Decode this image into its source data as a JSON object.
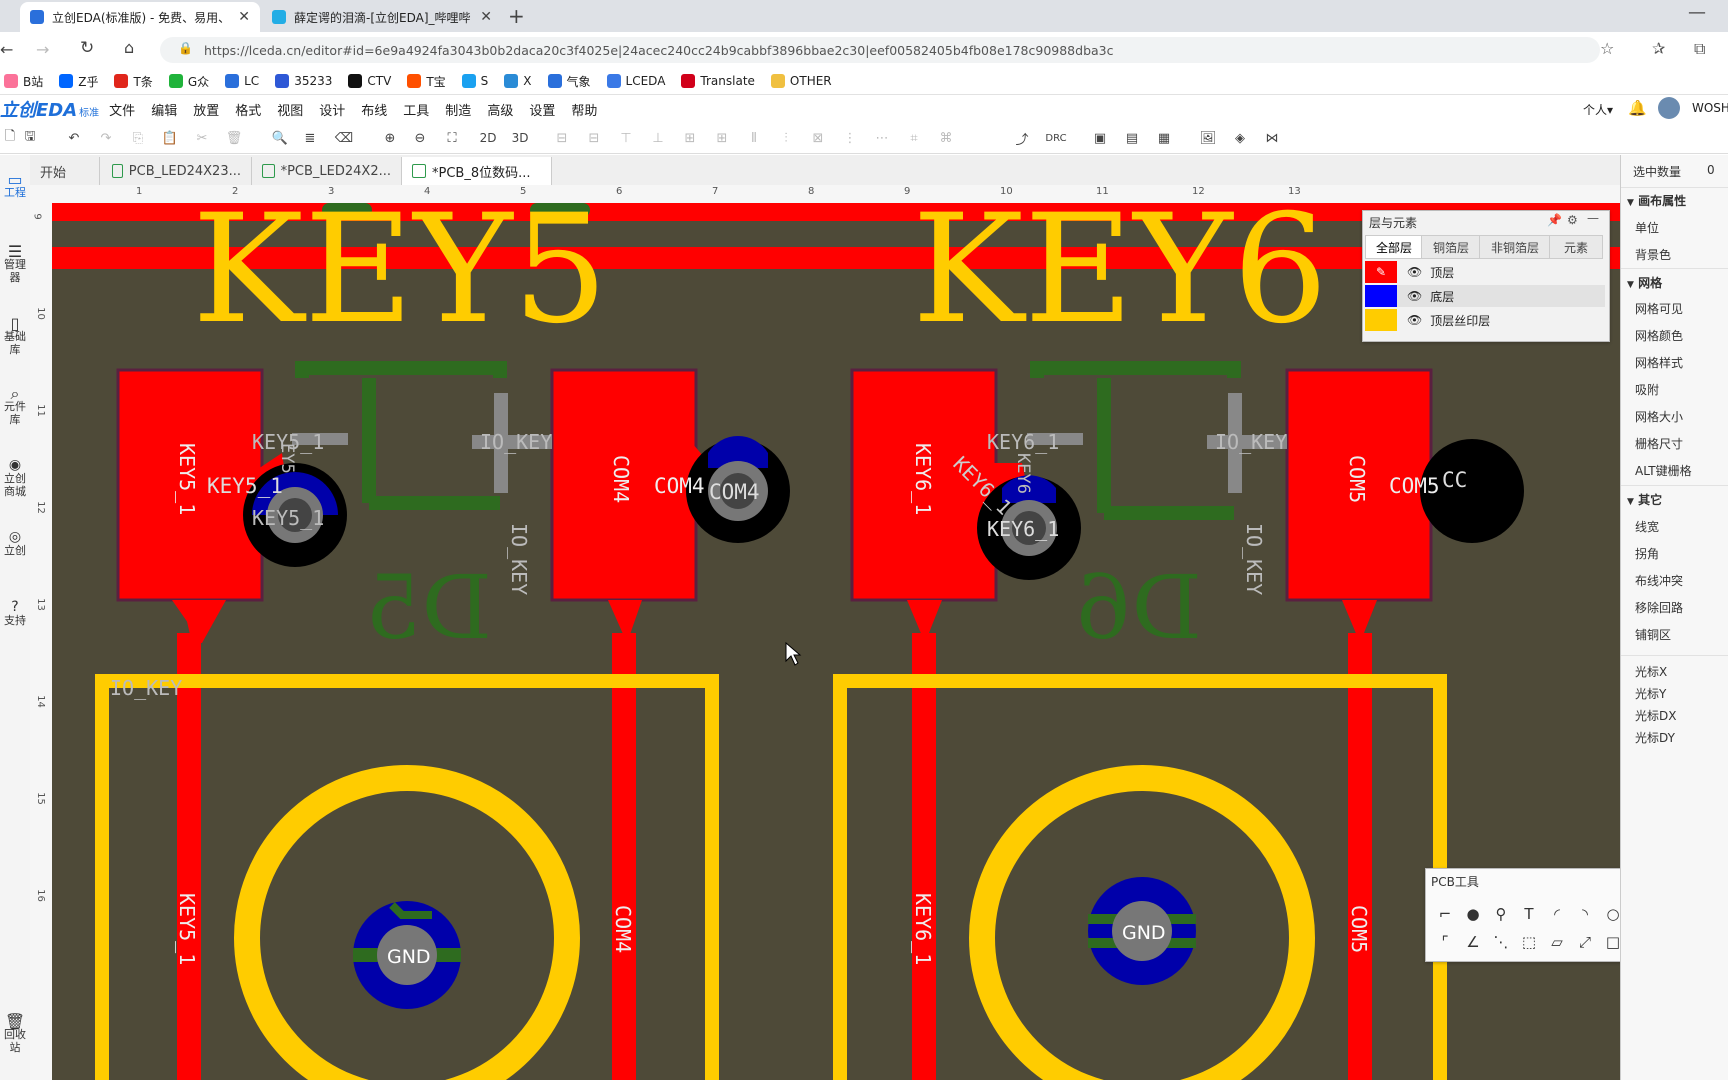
{
  "browser": {
    "tabs": [
      {
        "title": "立创EDA(标准版) - 免费、易用、",
        "close": "✕"
      },
      {
        "title": "薛定谔的泪滴-[立创EDA]_哔哩哔",
        "close": "✕"
      }
    ],
    "new_tab": "+",
    "url": "https://lceda.cn/editor#id=6e9a4924fa3043b0b2daca20c3f4025e|24acec240cc24b9cabbf3896bbae2c30|eef00582405b4fb08e178c90988dba3c",
    "bookmarks": [
      {
        "label": "B站",
        "color": "#fb7299"
      },
      {
        "label": "Z乎",
        "color": "#0066ff"
      },
      {
        "label": "T条",
        "color": "#e0261b"
      },
      {
        "label": "G众",
        "color": "#20b33b"
      },
      {
        "label": "LC",
        "color": "#2a6fdb"
      },
      {
        "label": "35233",
        "color": "#2e58d6"
      },
      {
        "label": "CTV",
        "color": "#111111"
      },
      {
        "label": "T宝",
        "color": "#ff5000"
      },
      {
        "label": "S",
        "color": "#1aa1f0"
      },
      {
        "label": "X",
        "color": "#2a8bd6"
      },
      {
        "label": "气象",
        "color": "#2a6fdb"
      },
      {
        "label": "LCEDA",
        "color": "#3a79e6"
      },
      {
        "label": "Translate",
        "color": "#d1001a"
      },
      {
        "label": "OTHER",
        "color": "#f0c040"
      }
    ]
  },
  "app": {
    "logo": "立创EDA",
    "logo_sub": "标准",
    "menu": [
      "文件",
      "编辑",
      "放置",
      "格式",
      "视图",
      "设计",
      "布线",
      "工具",
      "制造",
      "高级",
      "设置",
      "帮助"
    ],
    "user_menu": "个人▾",
    "user_name": "WOSH",
    "toolbar_text": {
      "two_d": "2D",
      "three_d": "3D",
      "drc": "DRC"
    }
  },
  "doc_tabs": [
    {
      "label": "开始"
    },
    {
      "label": "PCB_LED24X23..."
    },
    {
      "label": "*PCB_LED24X2..."
    },
    {
      "label": "*PCB_8位数码..."
    }
  ],
  "left_sidebar": [
    "工程",
    "管理器",
    "基础库",
    "元件库",
    "立创商城",
    "立创",
    "支持",
    "回收站"
  ],
  "ruler_h": [
    "1",
    "2",
    "3",
    "4",
    "5",
    "6",
    "7",
    "8",
    "9",
    "10",
    "11",
    "12",
    "13"
  ],
  "ruler_v": [
    "9",
    "10",
    "11",
    "12",
    "13",
    "14",
    "15",
    "16"
  ],
  "right_panel": {
    "selected_label": "选中数量",
    "selected_count": "0",
    "canvas_props": "画布属性",
    "unit": "单位",
    "bgcolor": "背景色",
    "grid_section": "网格",
    "grid_items": [
      "网格可见",
      "网格颜色",
      "网格样式",
      "吸附",
      "网格大小",
      "栅格尺寸",
      "ALT键栅格"
    ],
    "other_section": "其它",
    "other_items": [
      "线宽",
      "拐角",
      "布线冲突",
      "移除回路",
      "铺铜区"
    ],
    "cursor_items": [
      "光标X",
      "光标Y",
      "光标DX",
      "光标DY"
    ]
  },
  "layer_panel": {
    "title": "层与元素",
    "tabs": [
      "全部层",
      "铜箔层",
      "非铜箔层",
      "元素"
    ],
    "layers": [
      {
        "name": "顶层",
        "color": "#ff0000"
      },
      {
        "name": "底层",
        "color": "#0000ff"
      },
      {
        "name": "顶层丝印层",
        "color": "#ffcc00"
      }
    ]
  },
  "pcb_tools": {
    "title": "PCB工具",
    "minimize": "—"
  },
  "pcb_labels": {
    "key5": "KEY5",
    "key6": "KEY6",
    "key5_1": "KEY5_1",
    "key6_1": "KEY6_1",
    "key5_frag": "EY5",
    "key6_frag": "KEY6",
    "io_key": "IO_KEY",
    "com4": "COM4",
    "com5": "COM5",
    "com5_frag": "CC",
    "d5": "D5",
    "d6": "D6",
    "gnd": "GND"
  },
  "colors": {
    "board_bg": "#4e4a38",
    "top_layer": "#ff0000",
    "bottom_layer": "#0000aa",
    "silk": "#ffcc00",
    "bottom_silk": "#2e6b1f",
    "accent": "#1e6fd9"
  }
}
